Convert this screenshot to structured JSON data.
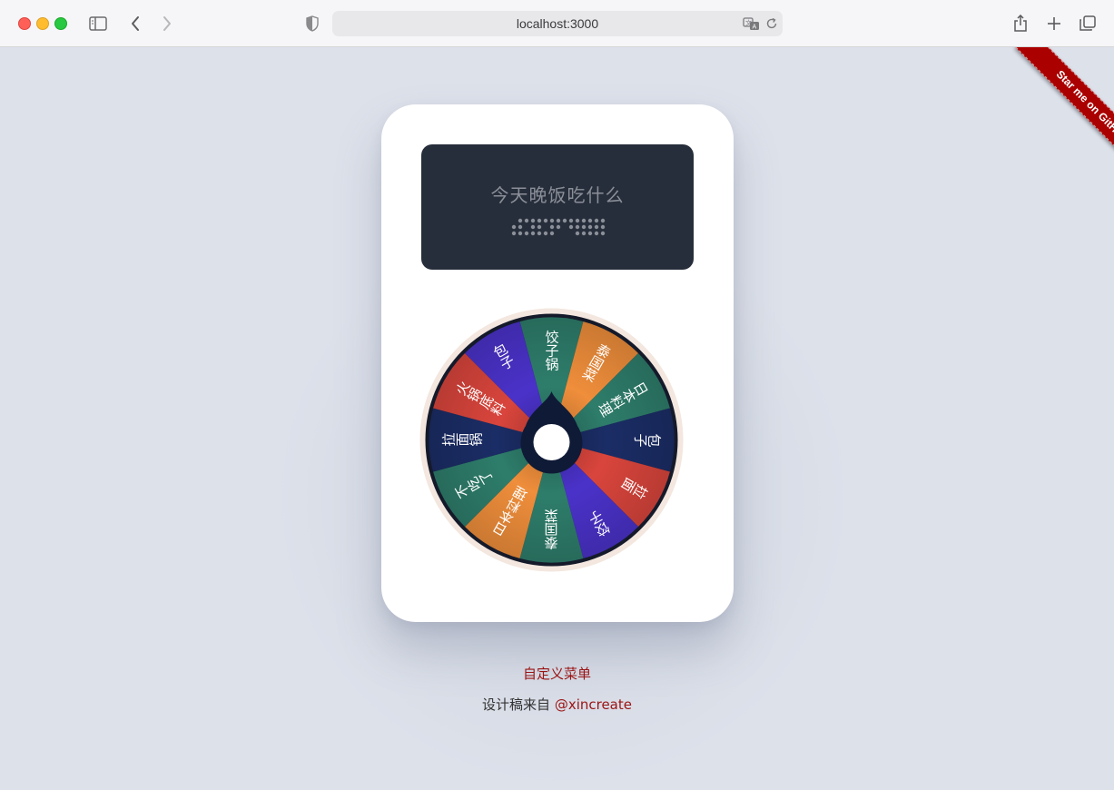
{
  "browser": {
    "url": "localhost:3000"
  },
  "icons": {
    "sidebar": "sidebar-icon",
    "back": "chevron-left-icon",
    "forward": "chevron-right-icon",
    "shield": "shield-icon",
    "translate": "translate-icon",
    "reload": "reload-icon",
    "share": "share-icon",
    "new_tab": "plus-icon",
    "tabs": "tabs-overview-icon"
  },
  "device": {
    "screen_title": "今天晚饭吃什么"
  },
  "wheel": {
    "segments": [
      {
        "label": "饺子锅",
        "color": "#2e7d6b"
      },
      {
        "label": "泰国菜",
        "color": "#ef8e3b"
      },
      {
        "label": "日本料理",
        "color": "#2e7d6b"
      },
      {
        "label": "包子",
        "color": "#1b2d66"
      },
      {
        "label": "拉面",
        "color": "#d9453c"
      },
      {
        "label": "饺子",
        "color": "#4a32c9"
      },
      {
        "label": "泰国菜",
        "color": "#2e7d6b"
      },
      {
        "label": "日本料理",
        "color": "#ef8e3b"
      },
      {
        "label": "不吃了",
        "color": "#2e7d6b"
      },
      {
        "label": "拉面锅",
        "color": "#1b2d66"
      },
      {
        "label": "火锅底料",
        "color": "#d9453c"
      },
      {
        "label": "包子",
        "color": "#4a32c9"
      }
    ],
    "rim_color": "#f3e7df",
    "hub_color": "#0f1a36"
  },
  "footer": {
    "custom_menu": "自定义菜单",
    "credit_prefix": "设计稿来自",
    "credit_handle": "@xincreate"
  },
  "ribbon": {
    "label": "Star me on GitHub"
  }
}
